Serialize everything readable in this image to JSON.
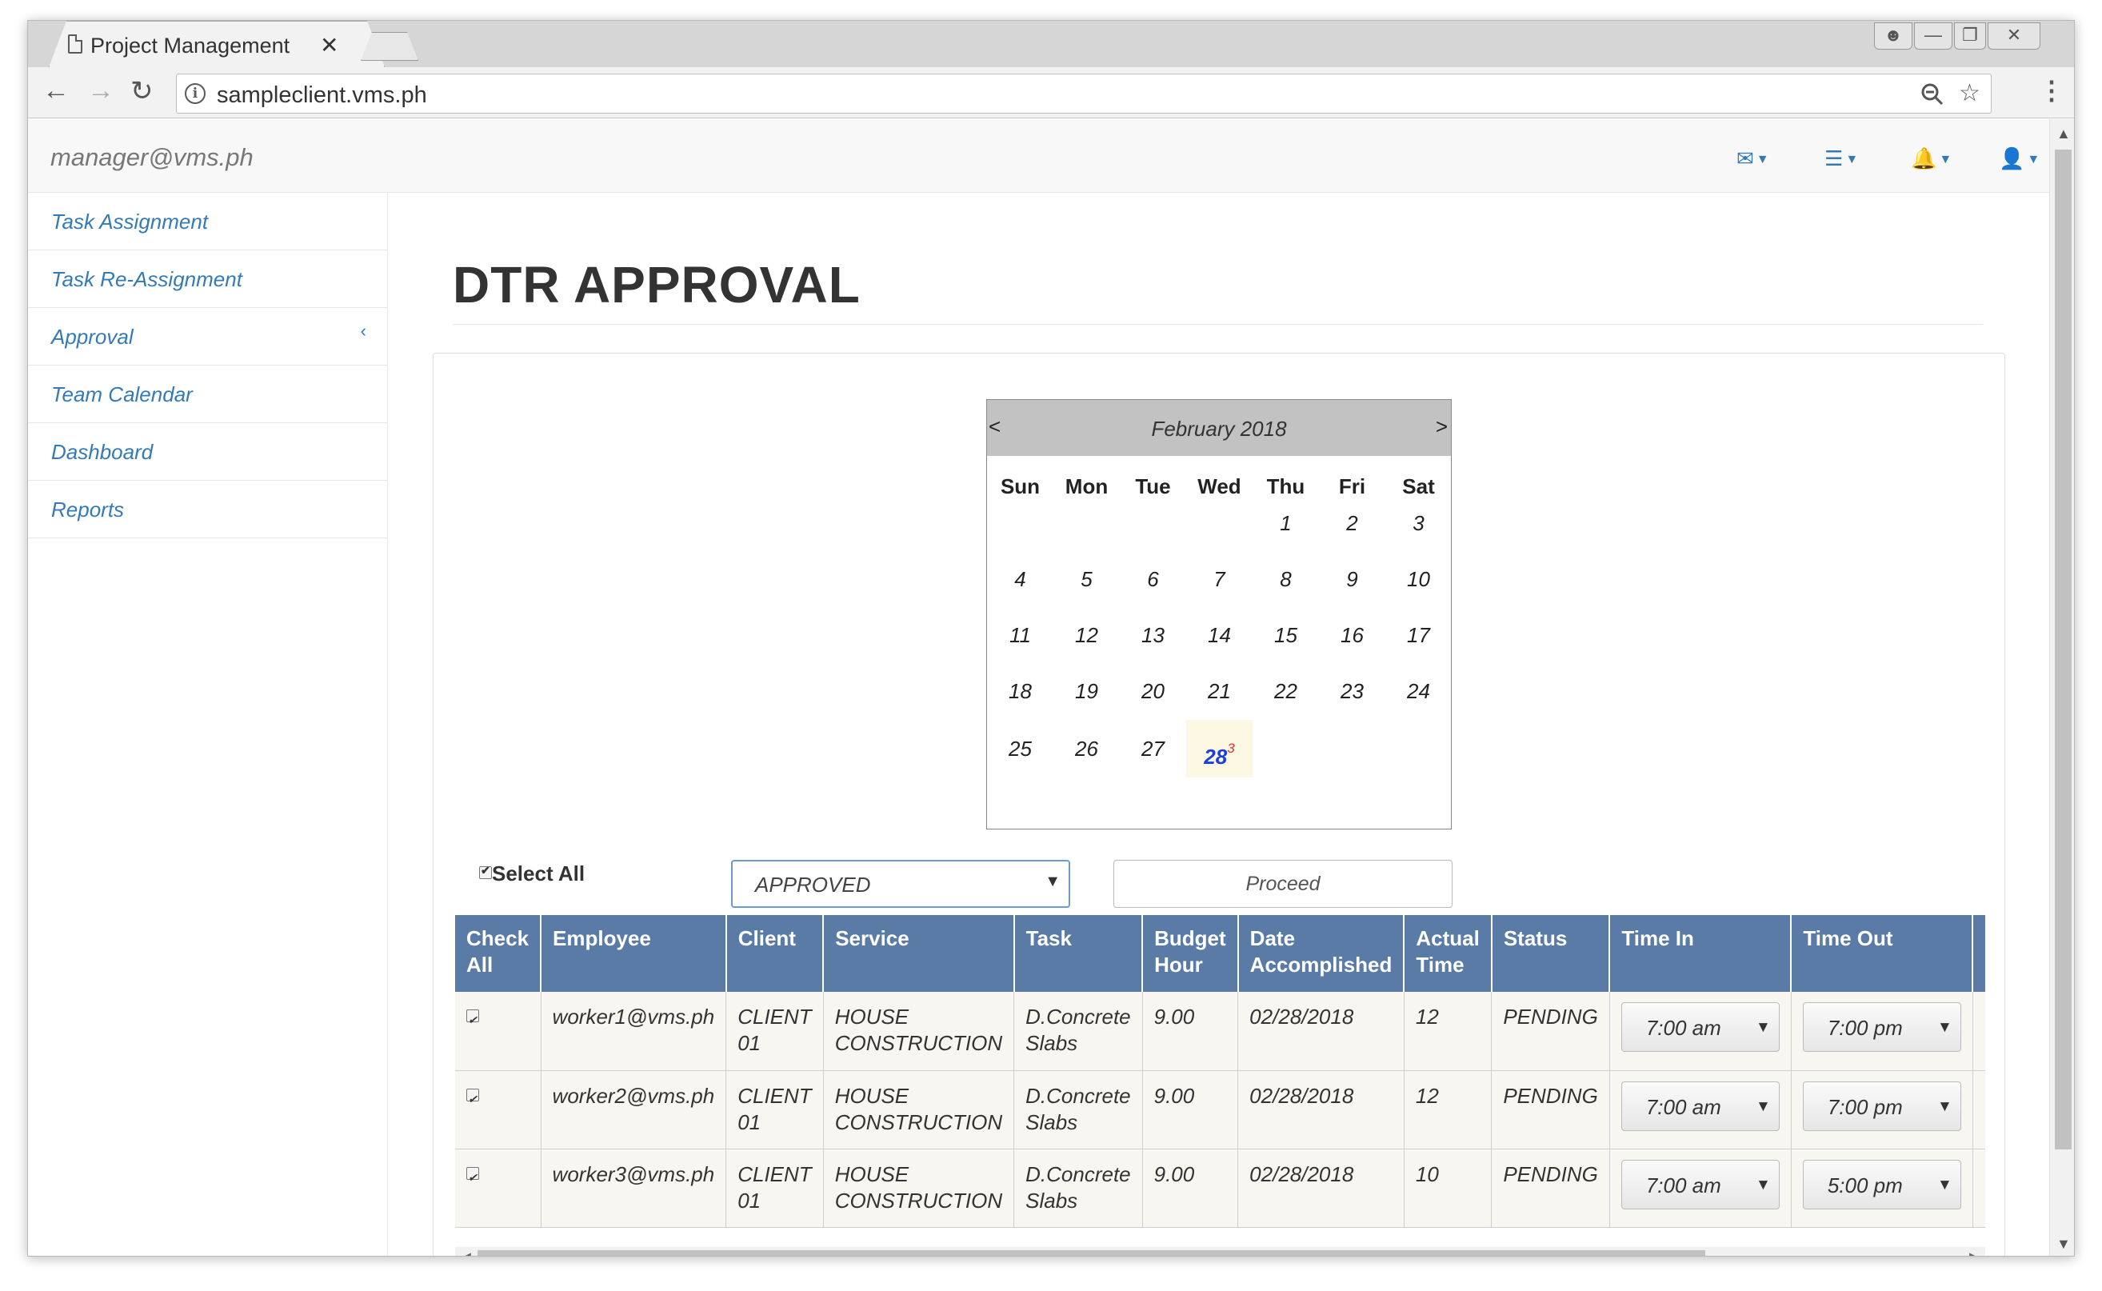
{
  "browser": {
    "tab_title": "Project Management",
    "tab_close": "✕",
    "url": "sampleclient.vms.ph",
    "back": "←",
    "forward": "→",
    "reload": "↻",
    "menu": "⋮"
  },
  "app": {
    "user": "manager@vms.ph",
    "sidebar": [
      {
        "label": "Task Assignment"
      },
      {
        "label": "Task Re-Assignment"
      },
      {
        "label": "Approval",
        "arrow": "‹"
      },
      {
        "label": "Team Calendar"
      },
      {
        "label": "Dashboard"
      },
      {
        "label": "Reports"
      }
    ],
    "page_title": "DTR APPROVAL"
  },
  "calendar": {
    "prev": "<",
    "next": ">",
    "month": "February 2018",
    "days_of_week": [
      "Sun",
      "Mon",
      "Tue",
      "Wed",
      "Thu",
      "Fri",
      "Sat"
    ],
    "first_weekday_index": 4,
    "days_in_month": 28,
    "highlighted_day": 28,
    "highlighted_badge": "3"
  },
  "controls": {
    "select_all": "Select All",
    "status_value": "APPROVED",
    "status_caret": "▼",
    "proceed": "Proceed"
  },
  "table": {
    "headers": {
      "check": "Check All",
      "employee": "Employee",
      "client": "Client",
      "service": "Service",
      "task": "Task",
      "budget": "Budget Hour",
      "date": "Date Accomplished",
      "actual": "Actual Time",
      "status": "Status",
      "time_in": "Time In",
      "time_out": "Time Out"
    },
    "rows": [
      {
        "employee": "worker1@vms.ph",
        "client": "CLIENT 01",
        "service": "HOUSE CONSTRUCTION",
        "task": "D.Concrete Slabs",
        "budget": "9.00",
        "date": "02/28/2018",
        "actual": "12",
        "status": "PENDING",
        "time_in": "7:00 am",
        "time_out": "7:00 pm"
      },
      {
        "employee": "worker2@vms.ph",
        "client": "CLIENT 01",
        "service": "HOUSE CONSTRUCTION",
        "task": "D.Concrete Slabs",
        "budget": "9.00",
        "date": "02/28/2018",
        "actual": "12",
        "status": "PENDING",
        "time_in": "7:00 am",
        "time_out": "7:00 pm"
      },
      {
        "employee": "worker3@vms.ph",
        "client": "CLIENT 01",
        "service": "HOUSE CONSTRUCTION",
        "task": "D.Concrete Slabs",
        "budget": "9.00",
        "date": "02/28/2018",
        "actual": "10",
        "status": "PENDING",
        "time_in": "7:00 am",
        "time_out": "5:00 pm"
      }
    ]
  },
  "colors": {
    "link": "#337ab7",
    "table_header": "#5a7ba6",
    "today_bg": "#fcf8e3",
    "today_text": "#1a3ee0"
  }
}
